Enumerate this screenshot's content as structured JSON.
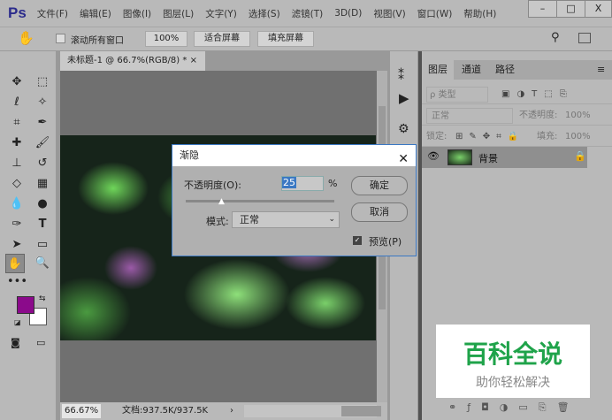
{
  "app": {
    "logo": "Ps",
    "menu": [
      "文件(F)",
      "编辑(E)",
      "图像(I)",
      "图层(L)",
      "文字(Y)",
      "选择(S)",
      "滤镜(T)",
      "3D(D)",
      "视图(V)",
      "窗口(W)",
      "帮助(H)"
    ],
    "win": {
      "min": "–",
      "max": "□",
      "close": "X"
    }
  },
  "options": {
    "scroll_all": "滚动所有窗口",
    "zoom100": "100%",
    "fit": "适合屏幕",
    "fill": "填充屏幕"
  },
  "doc": {
    "tab": "未标题-1 @ 66.7%(RGB/8) *",
    "zoom": "66.67%",
    "docinfo": "文档:937.5K/937.5K"
  },
  "colors": {
    "foreground": "#8b0a8b",
    "background": "#ffffff"
  },
  "panel": {
    "tabs": [
      "图层",
      "通道",
      "路径"
    ],
    "filter": "ρ 类型",
    "blend": "正常",
    "opacity_label": "不透明度:",
    "opacity": "100%",
    "lock_label": "锁定:",
    "fill_label": "填充:",
    "fill": "100%",
    "layer": "背景"
  },
  "dialog": {
    "title": "渐隐",
    "opacity_label": "不透明度(O):",
    "opacity_value": "25",
    "percent": "%",
    "ok": "确定",
    "cancel": "取消",
    "mode_label": "模式:",
    "mode_value": "正常",
    "preview": "预览(P)",
    "slider_percent": 25
  },
  "watermark": {
    "title": "百科全说",
    "subtitle": "助你轻松解决"
  }
}
